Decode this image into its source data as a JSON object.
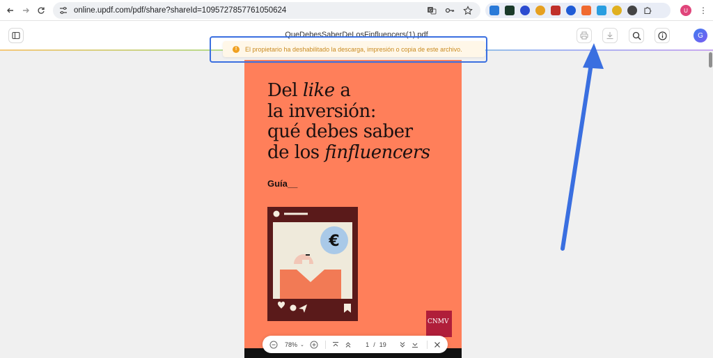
{
  "browser": {
    "url": "online.updf.com/pdf/share?shareId=1095727857761050624",
    "profile_initial": "U"
  },
  "toolbar": {
    "doc_title": "QueDebesSaberDeLosFinfluencers(1).pdf",
    "avatar_initial": "G"
  },
  "toast": {
    "message": "El propietario ha deshabilitado la descarga, impresión o copia de este archivo.",
    "icon": "warning-icon"
  },
  "cover": {
    "title_lines": [
      "Del like a",
      "la inversión:",
      "qué debes saber",
      "de los finfluencers"
    ],
    "title_line1_plain_start": "Del ",
    "title_line1_italic": "like",
    "title_line1_plain_end": " a",
    "title_line2": "la inversión:",
    "title_line3": "qué debes saber",
    "title_line4_plain": "de los ",
    "title_line4_italic": "finfluencers",
    "guia": "Guía__",
    "euro_symbol": "€",
    "logo_text": "CNMV"
  },
  "pagebar": {
    "zoom": "78%",
    "current_page": "1",
    "separator": "/",
    "total_pages": "19"
  },
  "colors": {
    "page_bg": "#ff7f5a",
    "highlight": "#3a6fe0",
    "toast_text": "#c98a20",
    "cnmv_red": "#b01e3a"
  }
}
